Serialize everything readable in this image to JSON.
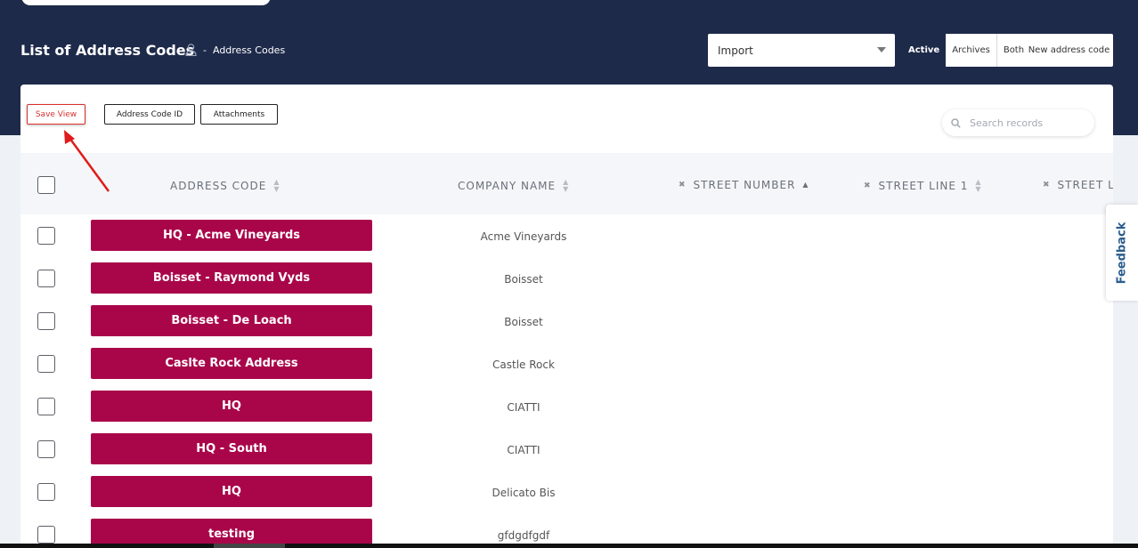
{
  "header": {
    "title": "List of Address Codes",
    "breadcrumb_separator": "-",
    "breadcrumb_current": "Address Codes",
    "import_select": {
      "value": "Import"
    },
    "status_filters": [
      {
        "label": "Active",
        "selected": true
      },
      {
        "label": "Archives",
        "selected": false
      },
      {
        "label": "Both",
        "selected": false
      }
    ],
    "new_button_label": "New address code"
  },
  "toolbar": {
    "save_view_label": "Save View",
    "column_buttons": [
      "Address Code ID",
      "Attachments"
    ],
    "search_placeholder": "Search records"
  },
  "table": {
    "columns": [
      "ADDRESS CODE",
      "COMPANY NAME",
      "STREET NUMBER",
      "STREET LINE 1",
      "STREET LI"
    ],
    "rows": [
      {
        "address_code": "HQ - Acme Vineyards",
        "company": "Acme Vineyards"
      },
      {
        "address_code": "Boisset - Raymond Vyds",
        "company": "Boisset"
      },
      {
        "address_code": "Boisset - De Loach",
        "company": "Boisset"
      },
      {
        "address_code": "Caslte Rock Address",
        "company": "Castle Rock"
      },
      {
        "address_code": "HQ",
        "company": "CIATTI"
      },
      {
        "address_code": "HQ - South",
        "company": "CIATTI"
      },
      {
        "address_code": "HQ",
        "company": "Delicato Bis"
      },
      {
        "address_code": "testing",
        "company": "gfdgdfgdf"
      }
    ]
  },
  "feedback_label": "Feedback",
  "colors": {
    "header_bg": "#1e2a4a",
    "code_button": "#a9064a",
    "save_view_accent": "#d9302c",
    "annotation_arrow": "#e01b1b"
  }
}
